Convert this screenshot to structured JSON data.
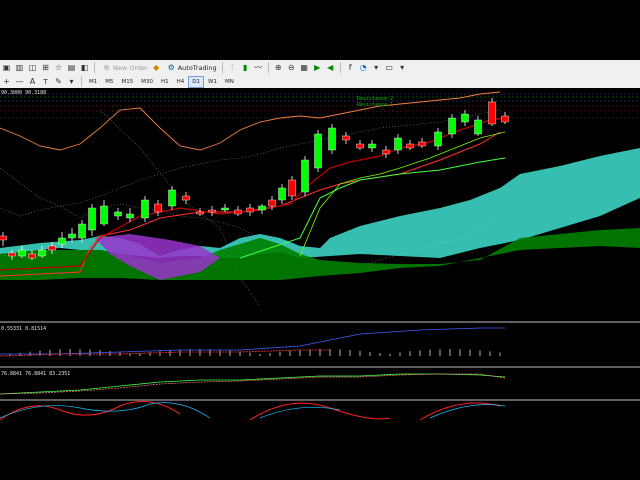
{
  "toolbar": {
    "new_order_label": "New Order",
    "autotrading_label": "AutoTrading"
  },
  "timeframes": [
    "M1",
    "M5",
    "M15",
    "M30",
    "H1",
    "H4",
    "D1",
    "W1",
    "MN"
  ],
  "active_timeframe": "D1",
  "chart": {
    "price_label": "90.3000 90.3188",
    "resistance2_label": "Resistance 2",
    "resistance1_label": "Resistance 1"
  },
  "indicators": {
    "macd_label": "0.55331 0.81514",
    "stoch_label": "76.8841 76.8841 83.2351"
  },
  "colors": {
    "bull_candle": "#00ff00",
    "bear_candle": "#ff0000",
    "cloud_bull": "#40e0d0",
    "cloud_bear": "#008000",
    "cloud_purple": "#9932cc",
    "background": "#000000",
    "resistance": "#00a000"
  }
}
